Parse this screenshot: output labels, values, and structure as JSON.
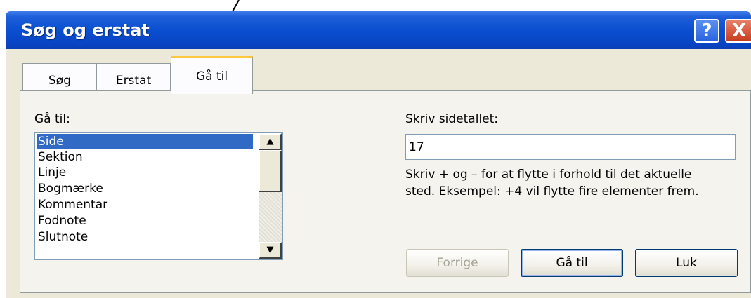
{
  "window": {
    "title": "Søg og erstat",
    "help_glyph": "?",
    "close_glyph": "X"
  },
  "tabs": [
    {
      "label": "Søg",
      "active": false
    },
    {
      "label": "Erstat",
      "active": false
    },
    {
      "label": "Gå til",
      "active": true
    }
  ],
  "goto": {
    "list_label": "Gå til:",
    "items": [
      "Side",
      "Sektion",
      "Linje",
      "Bogmærke",
      "Kommentar",
      "Fodnote",
      "Slutnote"
    ],
    "selected": "Side",
    "page_label": "Skriv sidetallet:",
    "page_value": "17",
    "hint_line1": "Skriv + og – for at flytte i forhold til det aktuelle",
    "hint_line2": "sted. Eksempel: +4 vil flytte fire elementer frem."
  },
  "buttons": {
    "prev": "Forrige",
    "goto": "Gå til",
    "close": "Luk"
  },
  "scroll_glyphs": {
    "up": "▲",
    "down": "▼"
  },
  "colors": {
    "titlebar": "#0a4fd0",
    "selection": "#316ac5",
    "dialog_bg": "#ece9d8",
    "active_tab_accent": "#ffc83c"
  }
}
